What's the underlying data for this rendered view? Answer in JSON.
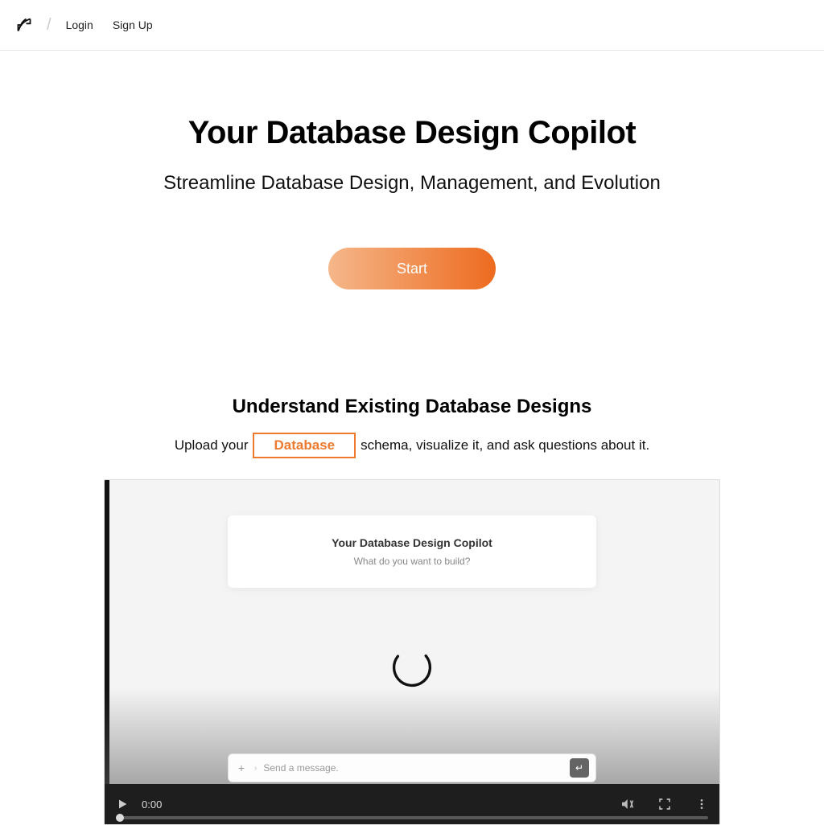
{
  "header": {
    "login": "Login",
    "signup": "Sign Up",
    "slash": "/"
  },
  "hero": {
    "title": "Your Database Design Copilot",
    "subtitle": "Streamline Database Design, Management, and Evolution",
    "cta": "Start"
  },
  "section2": {
    "heading": "Understand Existing Database Designs",
    "upload_prefix": "Upload your",
    "chip": "Database",
    "upload_suffix": "schema, visualize it, and ask questions about it."
  },
  "video_preview": {
    "card_title": "Your Database Design Copilot",
    "card_subtitle": "What do you want to build?",
    "msg_placeholder": "Send a message.",
    "msg_plus": "+",
    "msg_send_glyph": "↵",
    "time": "0:00"
  }
}
